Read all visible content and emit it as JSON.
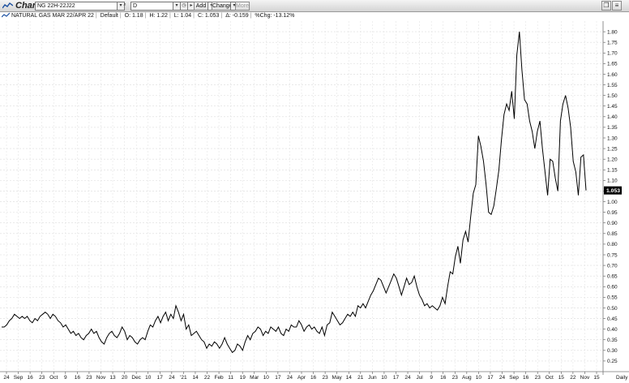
{
  "app": {
    "title": "Chart",
    "icon": "chart-line-icon",
    "symbol_value": "NG 22H-22J22",
    "period_value": "D",
    "add_label": "Add",
    "change_label": "Change",
    "more_label": "More"
  },
  "info_bar": {
    "series_name": "NATURAL GAS MAR 22/APR 22",
    "default_label": "Default",
    "open": "O: 1.18",
    "high": "H: 1.22",
    "low": "L: 1.04",
    "close": "C: 1.053",
    "change": "Δ: -0.159",
    "pct_change": "%Chg: -13.12%"
  },
  "chart_data": {
    "type": "line",
    "title": "NATURAL GAS MAR 22/APR 22",
    "xlabel": "",
    "ylabel": "",
    "ylim": [
      0.2,
      1.85
    ],
    "yticks": [
      0.25,
      0.3,
      0.35,
      0.4,
      0.45,
      0.5,
      0.55,
      0.6,
      0.65,
      0.7,
      0.75,
      0.8,
      0.85,
      0.9,
      0.95,
      1.0,
      1.05,
      1.1,
      1.15,
      1.2,
      1.25,
      1.3,
      1.35,
      1.4,
      1.45,
      1.5,
      1.55,
      1.6,
      1.65,
      1.7,
      1.75,
      1.8
    ],
    "last_value": "1.053",
    "grid": true,
    "x_axis_period": "Daily",
    "x_tick_labels": [
      "24",
      "Sep",
      "16",
      "23",
      "Oct",
      "9",
      "16",
      "23",
      "Nov",
      "13",
      "20",
      "Dec",
      "10",
      "17",
      "24",
      "'21",
      "14",
      "22",
      "Feb",
      "11",
      "19",
      "Mar",
      "10",
      "17",
      "24",
      "Apr",
      "16",
      "23",
      "May",
      "14",
      "21",
      "Jun",
      "10",
      "17",
      "24",
      "Jul",
      "9",
      "16",
      "23",
      "Aug",
      "10",
      "17",
      "24",
      "Sep",
      "16",
      "23",
      "Oct",
      "15",
      "22",
      "Nov",
      "15"
    ],
    "series": [
      {
        "values": [
          0.41,
          0.41,
          0.42,
          0.44,
          0.45,
          0.47,
          0.46,
          0.45,
          0.46,
          0.45,
          0.46,
          0.44,
          0.43,
          0.45,
          0.44,
          0.46,
          0.47,
          0.48,
          0.47,
          0.45,
          0.47,
          0.46,
          0.44,
          0.43,
          0.41,
          0.42,
          0.4,
          0.38,
          0.39,
          0.37,
          0.38,
          0.36,
          0.35,
          0.37,
          0.38,
          0.4,
          0.38,
          0.39,
          0.36,
          0.34,
          0.33,
          0.36,
          0.38,
          0.39,
          0.37,
          0.36,
          0.38,
          0.41,
          0.39,
          0.35,
          0.37,
          0.36,
          0.34,
          0.33,
          0.35,
          0.36,
          0.35,
          0.39,
          0.42,
          0.41,
          0.44,
          0.46,
          0.43,
          0.46,
          0.48,
          0.44,
          0.47,
          0.45,
          0.51,
          0.48,
          0.44,
          0.47,
          0.4,
          0.42,
          0.37,
          0.38,
          0.39,
          0.37,
          0.35,
          0.34,
          0.31,
          0.33,
          0.32,
          0.34,
          0.33,
          0.31,
          0.33,
          0.36,
          0.33,
          0.31,
          0.29,
          0.3,
          0.33,
          0.32,
          0.3,
          0.34,
          0.37,
          0.35,
          0.38,
          0.39,
          0.41,
          0.4,
          0.37,
          0.39,
          0.38,
          0.41,
          0.4,
          0.39,
          0.41,
          0.38,
          0.37,
          0.4,
          0.39,
          0.42,
          0.41,
          0.41,
          0.44,
          0.42,
          0.39,
          0.41,
          0.42,
          0.4,
          0.41,
          0.39,
          0.38,
          0.41,
          0.37,
          0.42,
          0.43,
          0.48,
          0.46,
          0.44,
          0.42,
          0.43,
          0.45,
          0.47,
          0.46,
          0.48,
          0.46,
          0.51,
          0.5,
          0.52,
          0.5,
          0.53,
          0.56,
          0.58,
          0.61,
          0.64,
          0.63,
          0.6,
          0.57,
          0.6,
          0.63,
          0.66,
          0.64,
          0.6,
          0.56,
          0.6,
          0.64,
          0.61,
          0.62,
          0.65,
          0.6,
          0.56,
          0.54,
          0.51,
          0.52,
          0.5,
          0.51,
          0.5,
          0.49,
          0.51,
          0.55,
          0.52,
          0.6,
          0.67,
          0.66,
          0.74,
          0.79,
          0.71,
          0.82,
          0.86,
          0.81,
          0.93,
          1.04,
          1.08,
          1.31,
          1.26,
          1.19,
          1.08,
          0.95,
          0.94,
          0.98,
          1.06,
          1.15,
          1.29,
          1.41,
          1.46,
          1.43,
          1.52,
          1.39,
          1.69,
          1.8,
          1.62,
          1.48,
          1.46,
          1.38,
          1.33,
          1.25,
          1.33,
          1.38,
          1.25,
          1.14,
          1.03,
          1.2,
          1.19,
          1.11,
          1.05,
          1.38,
          1.46,
          1.5,
          1.44,
          1.35,
          1.19,
          1.14,
          1.03,
          1.21,
          1.22,
          1.053
        ]
      }
    ]
  }
}
